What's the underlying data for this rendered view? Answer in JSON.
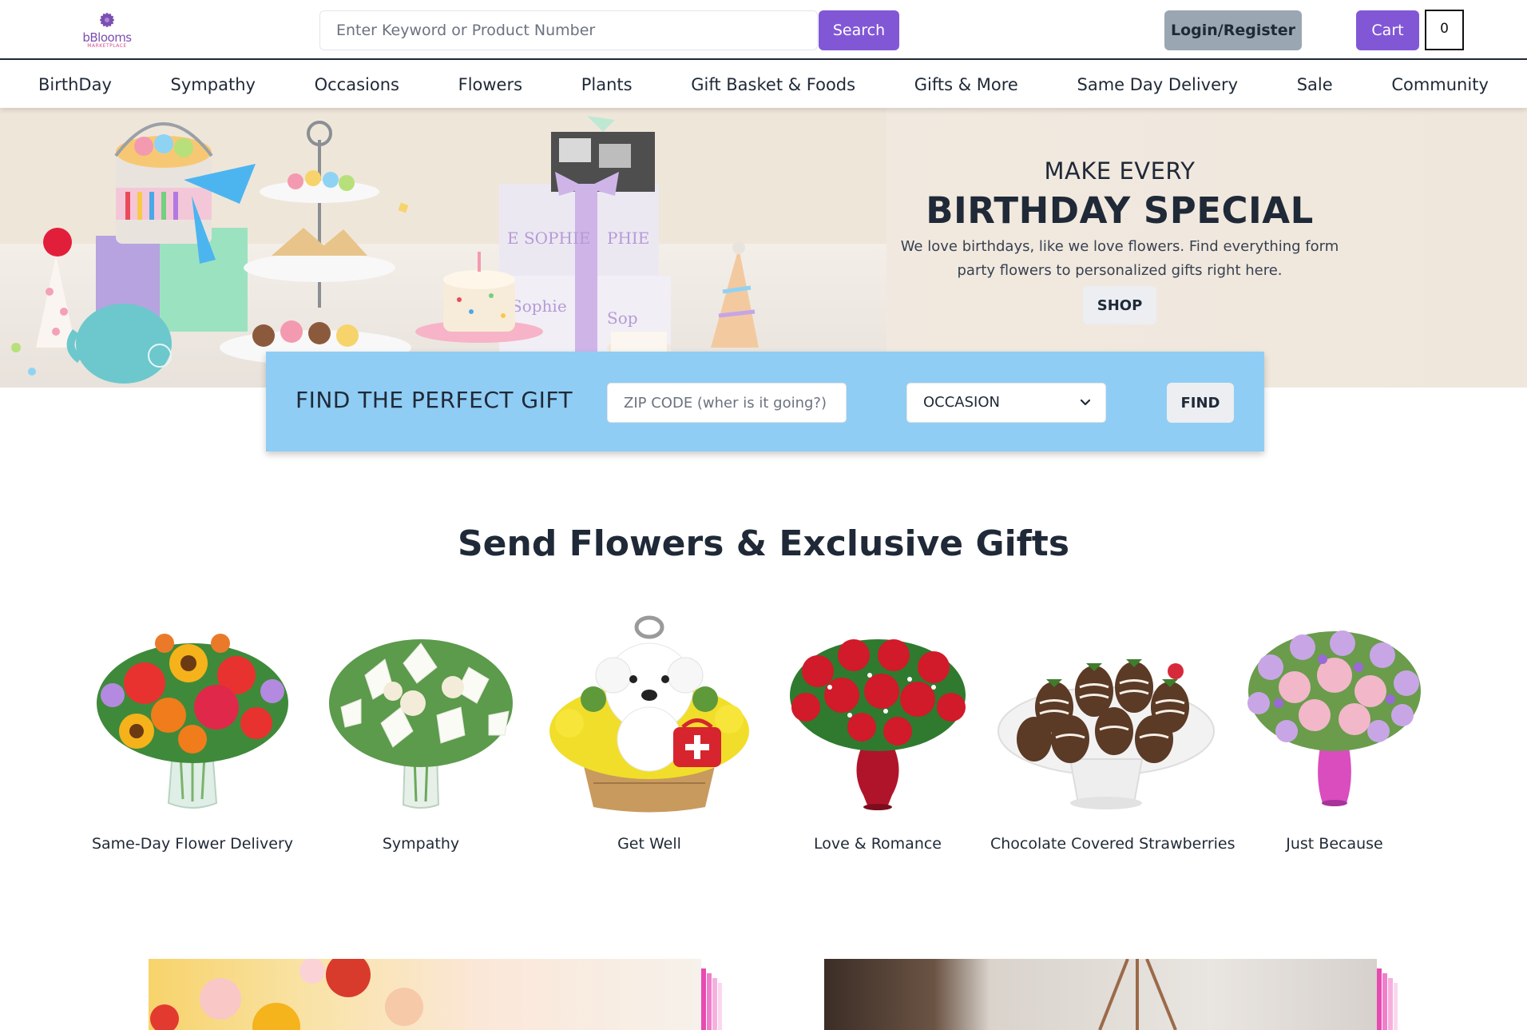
{
  "header": {
    "logo_text": "bBlooms",
    "logo_subtext": "MARKETPLACE",
    "search_placeholder": "Enter Keyword or Product Number",
    "search_button": "Search",
    "login_button": "Login/Register",
    "cart_button": "Cart",
    "cart_count": "0"
  },
  "nav": {
    "items": [
      "BirthDay",
      "Sympathy",
      "Occasions",
      "Flowers",
      "Plants",
      "Gift Basket & Foods",
      "Gifts & More",
      "Same Day Delivery",
      "Sale",
      "Community"
    ]
  },
  "hero": {
    "pretitle": "MAKE EVERY",
    "title": "BIRTHDAY SPECIAL",
    "description": "We love birthdays, like we love flowers. Find everything form party flowers to personalized gifts right here.",
    "button": "SHOP"
  },
  "finder": {
    "title": "FIND THE PERFECT GIFT",
    "zip_placeholder": "ZIP CODE (wher is it going?)",
    "occasion_value": "OCCASION",
    "find_button": "FIND"
  },
  "section": {
    "title": "Send Flowers & Exclusive Gifts"
  },
  "products": [
    {
      "label": "Same-Day Flower Delivery",
      "icon": "mixed-bouquet-icon"
    },
    {
      "label": "Sympathy",
      "icon": "white-lily-bouquet-icon"
    },
    {
      "label": "Get Well",
      "icon": "puppy-flower-basket-icon"
    },
    {
      "label": "Love & Romance",
      "icon": "red-roses-vase-icon"
    },
    {
      "label": "Chocolate Covered Strawberries",
      "icon": "strawberries-plate-icon"
    },
    {
      "label": "Just Because",
      "icon": "pink-bouquet-icon"
    }
  ],
  "colors": {
    "accent": "#8257d6",
    "finder_bg": "#90cdf4",
    "hero_bg": "#f1e9df",
    "login_bg": "#9aa6b2"
  }
}
